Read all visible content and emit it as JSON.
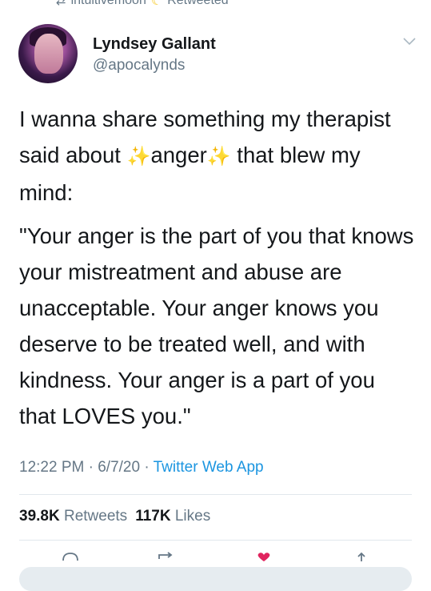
{
  "retweet_context": {
    "icon": "retweet-icon",
    "user": "intuitivemoon",
    "emoji_icon": "crescent-moon-icon",
    "label": "Retweeted"
  },
  "author": {
    "name": "Lyndsey Gallant",
    "handle": "@apocalynds",
    "avatar": "avatar-photo"
  },
  "tweet": {
    "p1_a": "I wanna share something my therapist said about ",
    "sparkle": "✨",
    "p1_b": "anger",
    "p1_c": " that blew my mind:",
    "p2": "\"Your anger is the part of you that knows your mistreatment and abuse are unacceptable. Your anger knows you deserve to be treated well, and with kindness. Your anger is a part of you that LOVES you.\""
  },
  "meta": {
    "time": "12:22 PM",
    "separator": " · ",
    "date": "6/7/20",
    "source": "Twitter Web App"
  },
  "stats": {
    "retweets_count": "39.8K",
    "retweets_label": "Retweets",
    "likes_count": "117K",
    "likes_label": "Likes"
  },
  "colors": {
    "text": "#14171a",
    "secondary": "#657786",
    "link": "#1b95e0",
    "like": "#e0245e",
    "divider": "#e1e8ed"
  }
}
